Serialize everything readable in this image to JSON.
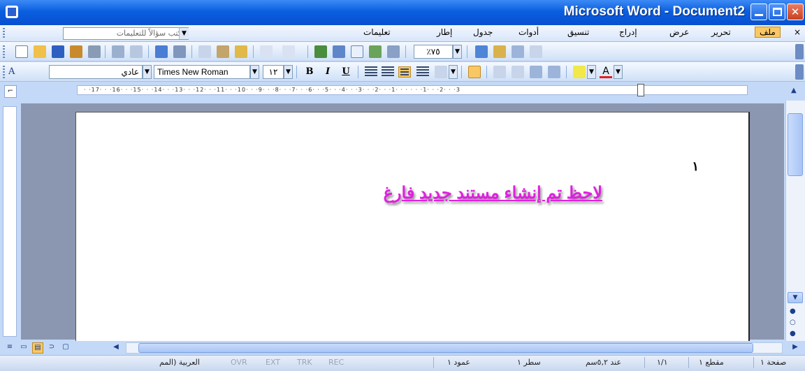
{
  "window": {
    "title": "Microsoft Word - Document2"
  },
  "menu": {
    "items": [
      "ملف",
      "تحرير",
      "عرض",
      "إدراج",
      "تنسيق",
      "أدوات",
      "جدول",
      "إطار",
      "تعليمات"
    ],
    "help_placeholder": "اكتب سؤالاً للتعليمات",
    "close_doc": "×"
  },
  "standard_toolbar": {
    "zoom": "٪٧٥"
  },
  "format_toolbar": {
    "style": "عادي",
    "font": "Times New Roman",
    "size": "١٢",
    "bold": "B",
    "italic": "I",
    "underline": "U"
  },
  "ruler": {
    "marks": "· ·17· · ·16· · ·15· · ·14· · ·13· · ·12· · ·11· · ·10· · ·9· · ·8· · ·7· · ·6· · ·5· · ·4· · ·3· · ·2· · ·1· · · · · ·1· · ·2· · ·3"
  },
  "document": {
    "page_number": "١",
    "text": "لاحظ تم إنشاء مستند جديد فارغ"
  },
  "status": {
    "page": "صفحة ١",
    "section": "مقطع ١",
    "pages": "١/١",
    "at": "عند ٥,٢سم",
    "line": "سطر ١",
    "column": "عمود ١",
    "modes": [
      "REC",
      "TRK",
      "EXT",
      "OVR"
    ],
    "language": "العربية (المم"
  },
  "colors": {
    "title_bar": "#0a5fe0",
    "highlight_text": "#e01fe0",
    "menu_file_bg": "#f9c864"
  }
}
